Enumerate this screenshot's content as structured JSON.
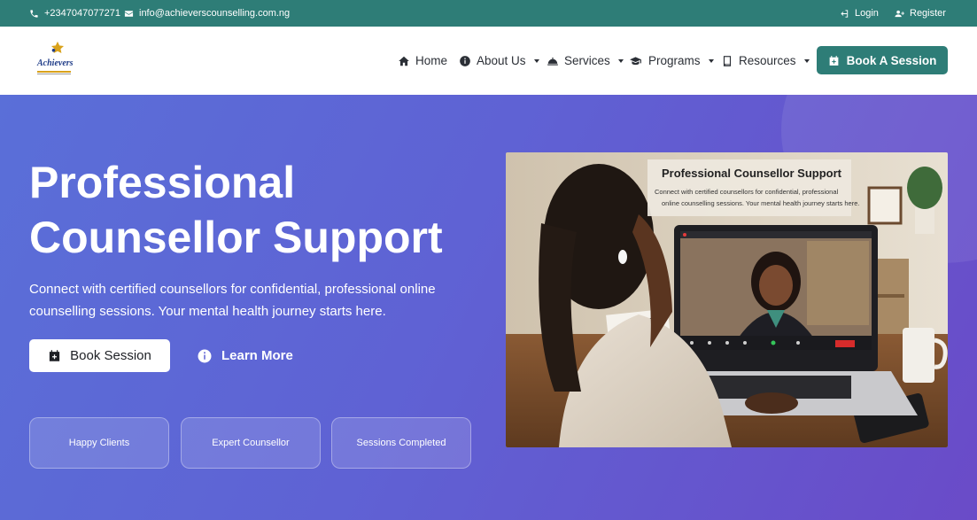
{
  "topbar": {
    "phone": "+2347047077271",
    "email": "info@achieverscounselling.com.ng",
    "login": "Login",
    "register": "Register"
  },
  "nav": {
    "logo_text": "Achievers",
    "items": [
      {
        "label": "Home",
        "icon": "home-icon",
        "dropdown": false
      },
      {
        "label": "About Us",
        "icon": "info-icon",
        "dropdown": true
      },
      {
        "label": "Services",
        "icon": "service-bell-icon",
        "dropdown": true
      },
      {
        "label": "Programs",
        "icon": "graduation-cap-icon",
        "dropdown": true
      },
      {
        "label": "Resources",
        "icon": "book-icon",
        "dropdown": true
      }
    ],
    "cta": "Book A Session"
  },
  "hero": {
    "title_line1": "Professional",
    "title_line2": "Counsellor Support",
    "subtitle": "Connect with certified counsellors for confidential, professional online counselling sessions. Your mental health journey starts here.",
    "book_button": "Book Session",
    "learn_button": "Learn More",
    "stats": [
      "Happy Clients",
      "Expert Counsellor",
      "Sessions Completed"
    ]
  },
  "image": {
    "overlay_title": "Professional Counsellor Support",
    "overlay_text_line1": "Connect with certified counsellors for confidential, professional",
    "overlay_text_line2": "online counselling sessions. Your mental health journey starts here.",
    "call_button": "Leave"
  },
  "colors": {
    "brand": "#2e7d77",
    "hero_start": "#5a6fd8",
    "hero_end": "#6a4bc8"
  }
}
